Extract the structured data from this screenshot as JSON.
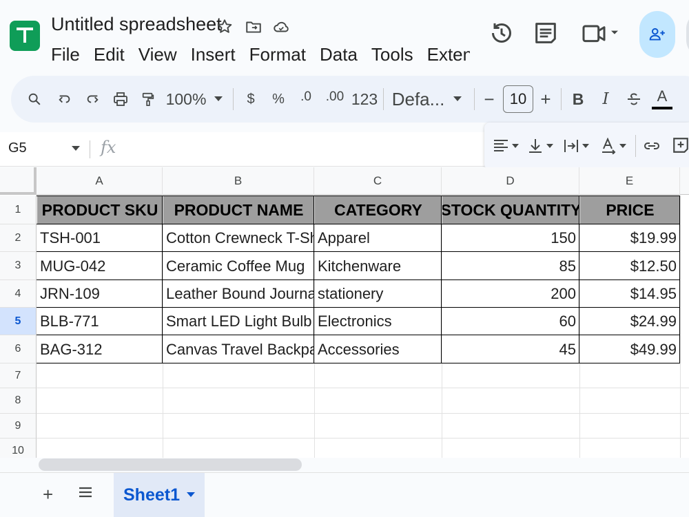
{
  "app": {
    "title": "Untitled spreadsheet"
  },
  "menu": [
    "File",
    "Edit",
    "View",
    "Insert",
    "Format",
    "Data",
    "Tools",
    "Extensions"
  ],
  "toolbar": {
    "zoom": "100%",
    "currency": "$",
    "percent": "%",
    "decrease_decimal": ".0",
    "increase_decimal": ".00",
    "number_format": "123",
    "font": "Defa...",
    "font_size": "10",
    "minus": "−",
    "plus": "+",
    "bold": "B",
    "italic": "I",
    "text_color": "A"
  },
  "formula_bar": {
    "cell_ref": "G5",
    "fx": "fx"
  },
  "columns": [
    "A",
    "B",
    "C",
    "D",
    "E"
  ],
  "rows": [
    "1",
    "2",
    "3",
    "4",
    "5",
    "6",
    "7",
    "8",
    "9",
    "10"
  ],
  "selected_row": "5",
  "table": {
    "headers": [
      "PRODUCT SKU",
      "PRODUCT NAME",
      "CATEGORY",
      "STOCK QUANTITY",
      "PRICE"
    ],
    "rows": [
      [
        "TSH-001",
        "Cotton Crewneck T-Shirt",
        "Apparel",
        "150",
        "$19.99"
      ],
      [
        "MUG-042",
        "Ceramic Coffee Mug",
        "Kitchenware",
        "85",
        "$12.50"
      ],
      [
        "JRN-109",
        "Leather Bound Journal",
        "stationery",
        "200",
        "$14.95"
      ],
      [
        "BLB-771",
        "Smart LED Light Bulb",
        "Electronics",
        "60",
        "$24.99"
      ],
      [
        "BAG-312",
        "Canvas Travel Backpack",
        "Accessories",
        "45",
        "$49.99"
      ]
    ]
  },
  "sheets": {
    "add": "+",
    "all_sheets": "≡",
    "active": "Sheet1"
  },
  "colors": {
    "accent": "#0b57d0",
    "header_fill": "#9e9e9e",
    "share_bg": "#c2e7ff",
    "logo": "#0f9d58"
  }
}
